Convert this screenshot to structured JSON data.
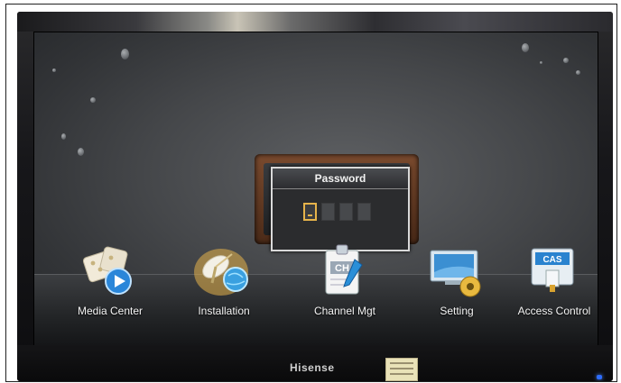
{
  "dialog": {
    "title": "Password",
    "pin_length": 4,
    "active_index": 0
  },
  "menu": {
    "items": [
      {
        "label": "Media Center",
        "icon": "media-center-icon"
      },
      {
        "label": "Installation",
        "icon": "installation-icon",
        "selected": true
      },
      {
        "label": "Channel Mgt",
        "icon": "channel-mgt-icon"
      },
      {
        "label": "Setting",
        "icon": "setting-icon"
      },
      {
        "label": "Access Control",
        "icon": "access-control-icon"
      }
    ]
  },
  "icons": {
    "channel_badge": "CH",
    "cas_badge": "CAS"
  },
  "monitor": {
    "brand": "Hisense"
  },
  "colors": {
    "accent": "#e6b34a",
    "dialog_border": "#d9d9d9",
    "power_led": "#2d6cff"
  }
}
